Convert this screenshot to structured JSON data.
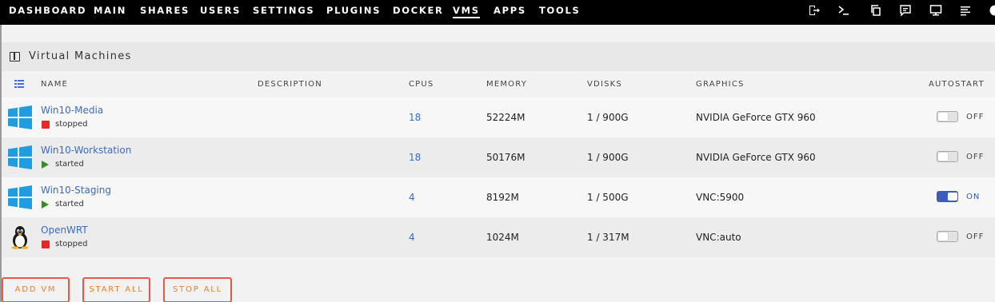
{
  "nav": {
    "items": [
      {
        "label": "DASHBOARD",
        "active": false
      },
      {
        "label": "MAIN",
        "active": false
      },
      {
        "label": "SHARES",
        "active": false
      },
      {
        "label": "USERS",
        "active": false
      },
      {
        "label": "SETTINGS",
        "active": false
      },
      {
        "label": "PLUGINS",
        "active": false
      },
      {
        "label": "DOCKER",
        "active": false
      },
      {
        "label": "VMS",
        "active": true
      },
      {
        "label": "APPS",
        "active": false
      },
      {
        "label": "TOOLS",
        "active": false
      }
    ],
    "icons": [
      "logout-icon",
      "terminal-icon",
      "copy-icon",
      "feedback-icon",
      "monitor-icon",
      "log-icon",
      "info-icon"
    ]
  },
  "section": {
    "title": "Virtual Machines",
    "icon": "columns-icon"
  },
  "table": {
    "columns": [
      "NAME",
      "DESCRIPTION",
      "CPUS",
      "MEMORY",
      "VDISKS",
      "GRAPHICS",
      "AUTOSTART"
    ],
    "rows": [
      {
        "name": "Win10-Media",
        "os": "windows",
        "state": "stopped",
        "description": "",
        "cpus": "18",
        "memory": "52224M",
        "vdisks": "1 / 900G",
        "graphics": "NVIDIA GeForce GTX 960",
        "autostart": "OFF"
      },
      {
        "name": "Win10-Workstation",
        "os": "windows",
        "state": "started",
        "description": "",
        "cpus": "18",
        "memory": "50176M",
        "vdisks": "1 / 900G",
        "graphics": "NVIDIA GeForce GTX 960",
        "autostart": "OFF"
      },
      {
        "name": "Win10-Staging",
        "os": "windows",
        "state": "started",
        "description": "",
        "cpus": "4",
        "memory": "8192M",
        "vdisks": "1 / 500G",
        "graphics": "VNC:5900",
        "autostart": "ON"
      },
      {
        "name": "OpenWRT",
        "os": "linux",
        "state": "stopped",
        "description": "",
        "cpus": "4",
        "memory": "1024M",
        "vdisks": "1 / 317M",
        "graphics": "VNC:auto",
        "autostart": "OFF"
      }
    ]
  },
  "buttons": {
    "add_vm": "ADD VM",
    "start_all": "START ALL",
    "stop_all": "STOP ALL"
  },
  "colors": {
    "nav_bg": "#000000",
    "link": "#3d6bbf",
    "stopped": "#e22828",
    "started": "#3b8a29",
    "toggle_on": "#3b5db8",
    "button_text": "#f07f2a",
    "button_border": "#e8574a",
    "windows_logo": "#1e9ee0"
  }
}
